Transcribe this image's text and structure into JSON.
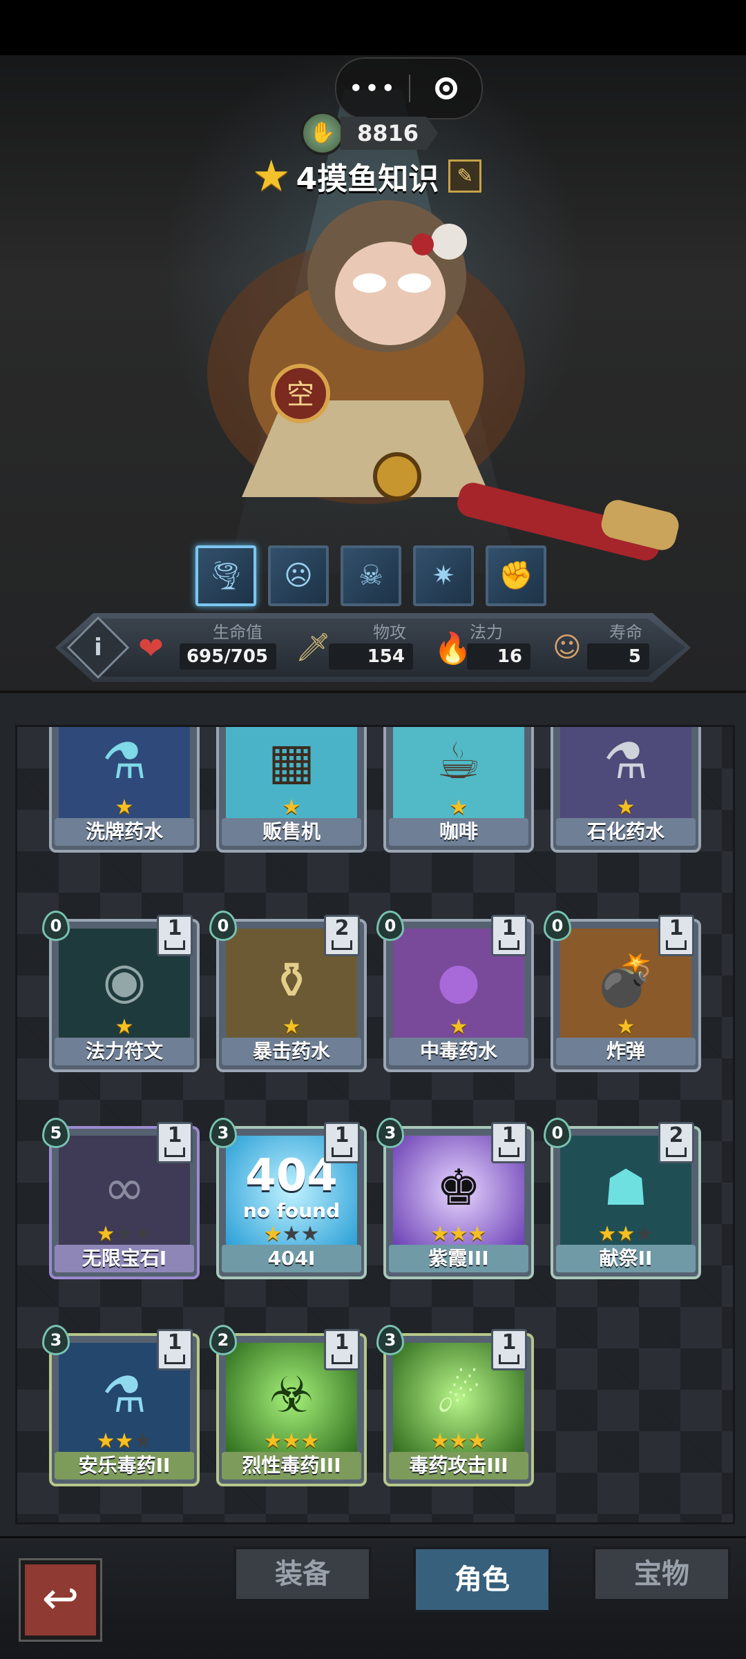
{
  "top": {
    "currency_value": "8816",
    "title": "4摸鱼知识",
    "menu_more": "•••",
    "menu_close": "◉"
  },
  "skills": [
    {
      "icon": "tornado-skill-icon",
      "active": true
    },
    {
      "icon": "roar-skill-icon",
      "active": false
    },
    {
      "icon": "demon-mask-skill-icon",
      "active": false
    },
    {
      "icon": "burst-skill-icon",
      "active": false
    },
    {
      "icon": "fist-skill-icon",
      "active": false
    }
  ],
  "stats": {
    "hp": {
      "label": "生命值",
      "value": "695/705"
    },
    "attack": {
      "label": "物攻",
      "value": "154"
    },
    "magic": {
      "label": "法力",
      "value": "16"
    },
    "lifespan": {
      "label": "寿命",
      "value": "5"
    }
  },
  "cards": [
    {
      "name": "洗牌药水",
      "cost": null,
      "count": null,
      "stars": 1,
      "max_stars": 1,
      "theme": "default",
      "icon": "shuffle-potion-icon"
    },
    {
      "name": "贩售机",
      "cost": null,
      "count": null,
      "stars": 1,
      "max_stars": 1,
      "theme": "default",
      "icon": "vending-machine-icon"
    },
    {
      "name": "咖啡",
      "cost": null,
      "count": null,
      "stars": 1,
      "max_stars": 1,
      "theme": "default",
      "icon": "coffee-icon"
    },
    {
      "name": "石化药水",
      "cost": null,
      "count": null,
      "stars": 1,
      "max_stars": 1,
      "theme": "default",
      "icon": "petrify-potion-icon"
    },
    {
      "name": "法力符文",
      "cost": "0",
      "count": "1",
      "stars": 1,
      "max_stars": 1,
      "theme": "default",
      "icon": "mana-rune-icon"
    },
    {
      "name": "暴击药水",
      "cost": "0",
      "count": "2",
      "stars": 1,
      "max_stars": 1,
      "theme": "default",
      "icon": "crit-potion-icon"
    },
    {
      "name": "中毒药水",
      "cost": "0",
      "count": "1",
      "stars": 1,
      "max_stars": 1,
      "theme": "default",
      "icon": "poison-potion-icon"
    },
    {
      "name": "炸弹",
      "cost": "0",
      "count": "1",
      "stars": 1,
      "max_stars": 1,
      "theme": "default",
      "icon": "bomb-icon"
    },
    {
      "name": "无限宝石I",
      "cost": "5",
      "count": "1",
      "stars": 1,
      "max_stars": 3,
      "theme": "purple",
      "icon": "infinity-gem-icon"
    },
    {
      "name": "404I",
      "cost": "3",
      "count": "1",
      "stars": 1,
      "max_stars": 3,
      "theme": "teal",
      "icon": "error-404-icon",
      "art_text": "404",
      "art_sub": "no found"
    },
    {
      "name": "紫霞III",
      "cost": "3",
      "count": "1",
      "stars": 3,
      "max_stars": 3,
      "theme": "teal",
      "icon": "purple-cloud-icon"
    },
    {
      "name": "献祭II",
      "cost": "0",
      "count": "2",
      "stars": 2,
      "max_stars": 3,
      "theme": "teal",
      "icon": "sacrifice-icon"
    },
    {
      "name": "安乐毒药II",
      "cost": "3",
      "count": "1",
      "stars": 2,
      "max_stars": 3,
      "theme": "green",
      "icon": "euthanasia-poison-icon"
    },
    {
      "name": "烈性毒药III",
      "cost": "2",
      "count": "1",
      "stars": 3,
      "max_stars": 3,
      "theme": "green",
      "icon": "strong-poison-icon"
    },
    {
      "name": "毒药攻击III",
      "cost": "3",
      "count": "1",
      "stars": 3,
      "max_stars": 3,
      "theme": "green",
      "icon": "poison-attack-icon"
    }
  ],
  "nav": {
    "tab_equipment": "装备",
    "tab_character": "角色",
    "tab_treasure": "宝物",
    "active": "角色"
  }
}
